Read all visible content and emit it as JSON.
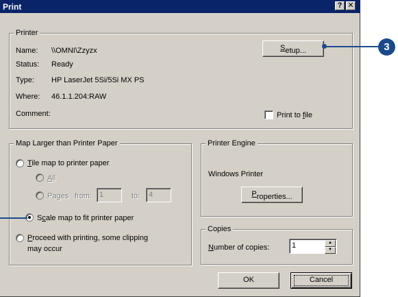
{
  "window": {
    "title": "Print",
    "help_btn": "?",
    "close_btn": "✕"
  },
  "printer_group": {
    "legend": "Printer",
    "rows": [
      {
        "label": "Name:",
        "value": "\\\\OMNI\\Zzyzx"
      },
      {
        "label": "Status:",
        "value": "Ready"
      },
      {
        "label": "Type:",
        "value": "HP LaserJet 5Si/5Si MX PS"
      },
      {
        "label": "Where:",
        "value": "46.1.1.204:RAW"
      },
      {
        "label": "Comment:",
        "value": ""
      }
    ],
    "setup_button": {
      "pre": "",
      "ul": "S",
      "post": "etup..."
    },
    "print_to_file": {
      "pre": "Print to ",
      "ul": "f",
      "post": "ile",
      "checked": false
    }
  },
  "map_group": {
    "legend": "Map Larger than Printer Paper",
    "tile": {
      "pre": "",
      "ul": "T",
      "post": "ile map to printer paper",
      "selected": false
    },
    "all": {
      "pre": "",
      "ul": "A",
      "post": "ll",
      "enabled": false
    },
    "pages": {
      "label": "Pages",
      "from_label": "from:",
      "from_value": "1",
      "to_label": "to:",
      "to_value": "4",
      "enabled": false
    },
    "scale": {
      "pre": "S",
      "ul": "c",
      "post": "ale map to fit printer paper",
      "selected": true
    },
    "proceed": {
      "pre": "",
      "ul": "P",
      "post": "roceed with printing, some clipping",
      "line2": "may occur",
      "selected": false
    }
  },
  "engine_group": {
    "legend": "Printer Engine",
    "engine_name": "Windows Printer",
    "properties_button": {
      "pre": "",
      "ul": "P",
      "post": "roperties..."
    }
  },
  "copies_group": {
    "legend": "Copies",
    "label": {
      "pre": "",
      "ul": "N",
      "post": "umber of copies:"
    },
    "value": "1"
  },
  "ok_button": "OK",
  "cancel_button": "Cancel",
  "callout": {
    "number": "3",
    "color": "#1a4a8c"
  }
}
